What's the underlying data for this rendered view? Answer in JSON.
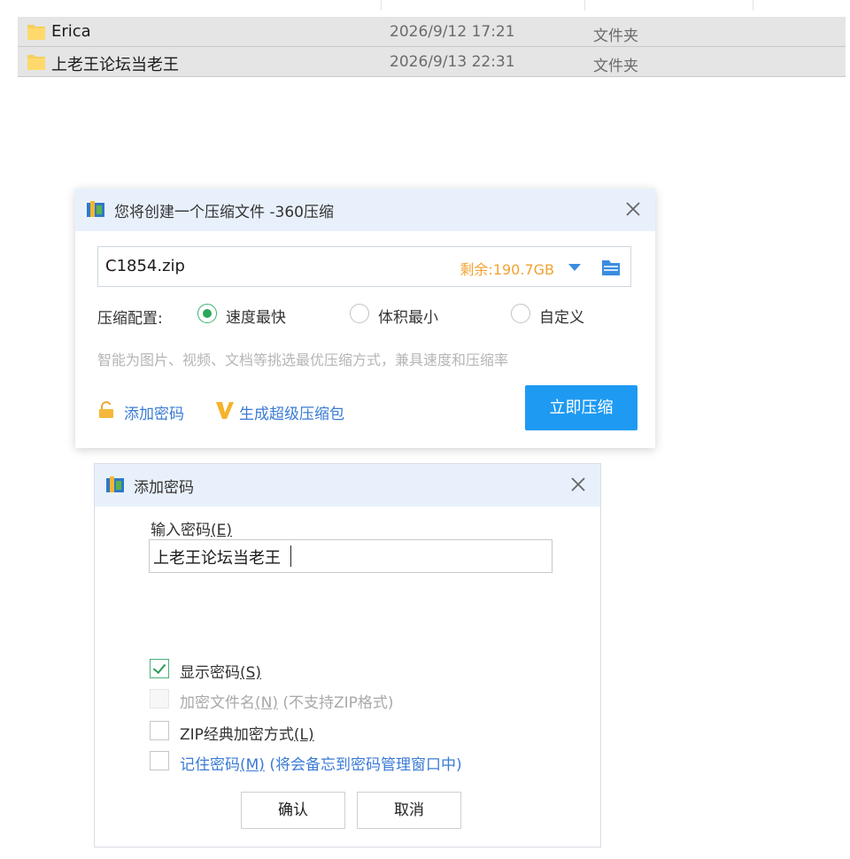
{
  "explorer": {
    "files": [
      {
        "name": "Erica",
        "modified": "2026/9/12 17:21",
        "type": "文件夹"
      },
      {
        "name": "上老王论坛当老王",
        "modified": "2026/9/13 22:31",
        "type": "文件夹"
      }
    ]
  },
  "compress_dialog": {
    "title": "您将创建一个压缩文件 -360压缩",
    "file_name": "C1854.zip",
    "remaining": "剩余:190.7GB",
    "config_label": "压缩配置:",
    "options": [
      {
        "label": "速度最快",
        "selected": true
      },
      {
        "label": "体积最小",
        "selected": false
      },
      {
        "label": "自定义",
        "selected": false
      }
    ],
    "hint": "智能为图片、视频、文档等挑选最优压缩方式，兼具速度和压缩率",
    "add_password_link": "添加密码",
    "super_package_link": "生成超级压缩包",
    "compress_button": "立即压缩"
  },
  "password_dialog": {
    "title": "添加密码",
    "input_label": "输入密码",
    "input_label_key": "(E)",
    "password_value": "上老王论坛当老王",
    "checkboxes": [
      {
        "label": "显示密码",
        "key": "(S)",
        "suffix": "",
        "checked": true,
        "disabled": false
      },
      {
        "label": "加密文件名",
        "key": "(N)",
        "suffix": " (不支持ZIP格式)",
        "checked": false,
        "disabled": true
      },
      {
        "label": "ZIP经典加密方式",
        "key": "(L)",
        "suffix": "",
        "checked": false,
        "disabled": false
      },
      {
        "label": "记住密码",
        "key": "(M)",
        "suffix": " (将会备忘到密码管理窗口中)",
        "checked": false,
        "disabled": false
      }
    ],
    "ok_button": "确认",
    "cancel_button": "取消"
  },
  "colors": {
    "accent_blue": "#1e9af2",
    "link_blue": "#3a7bd5",
    "remaining_orange": "#f0a330",
    "check_green": "#2aa85a",
    "title_bar_bg": "#e8f1fb"
  }
}
